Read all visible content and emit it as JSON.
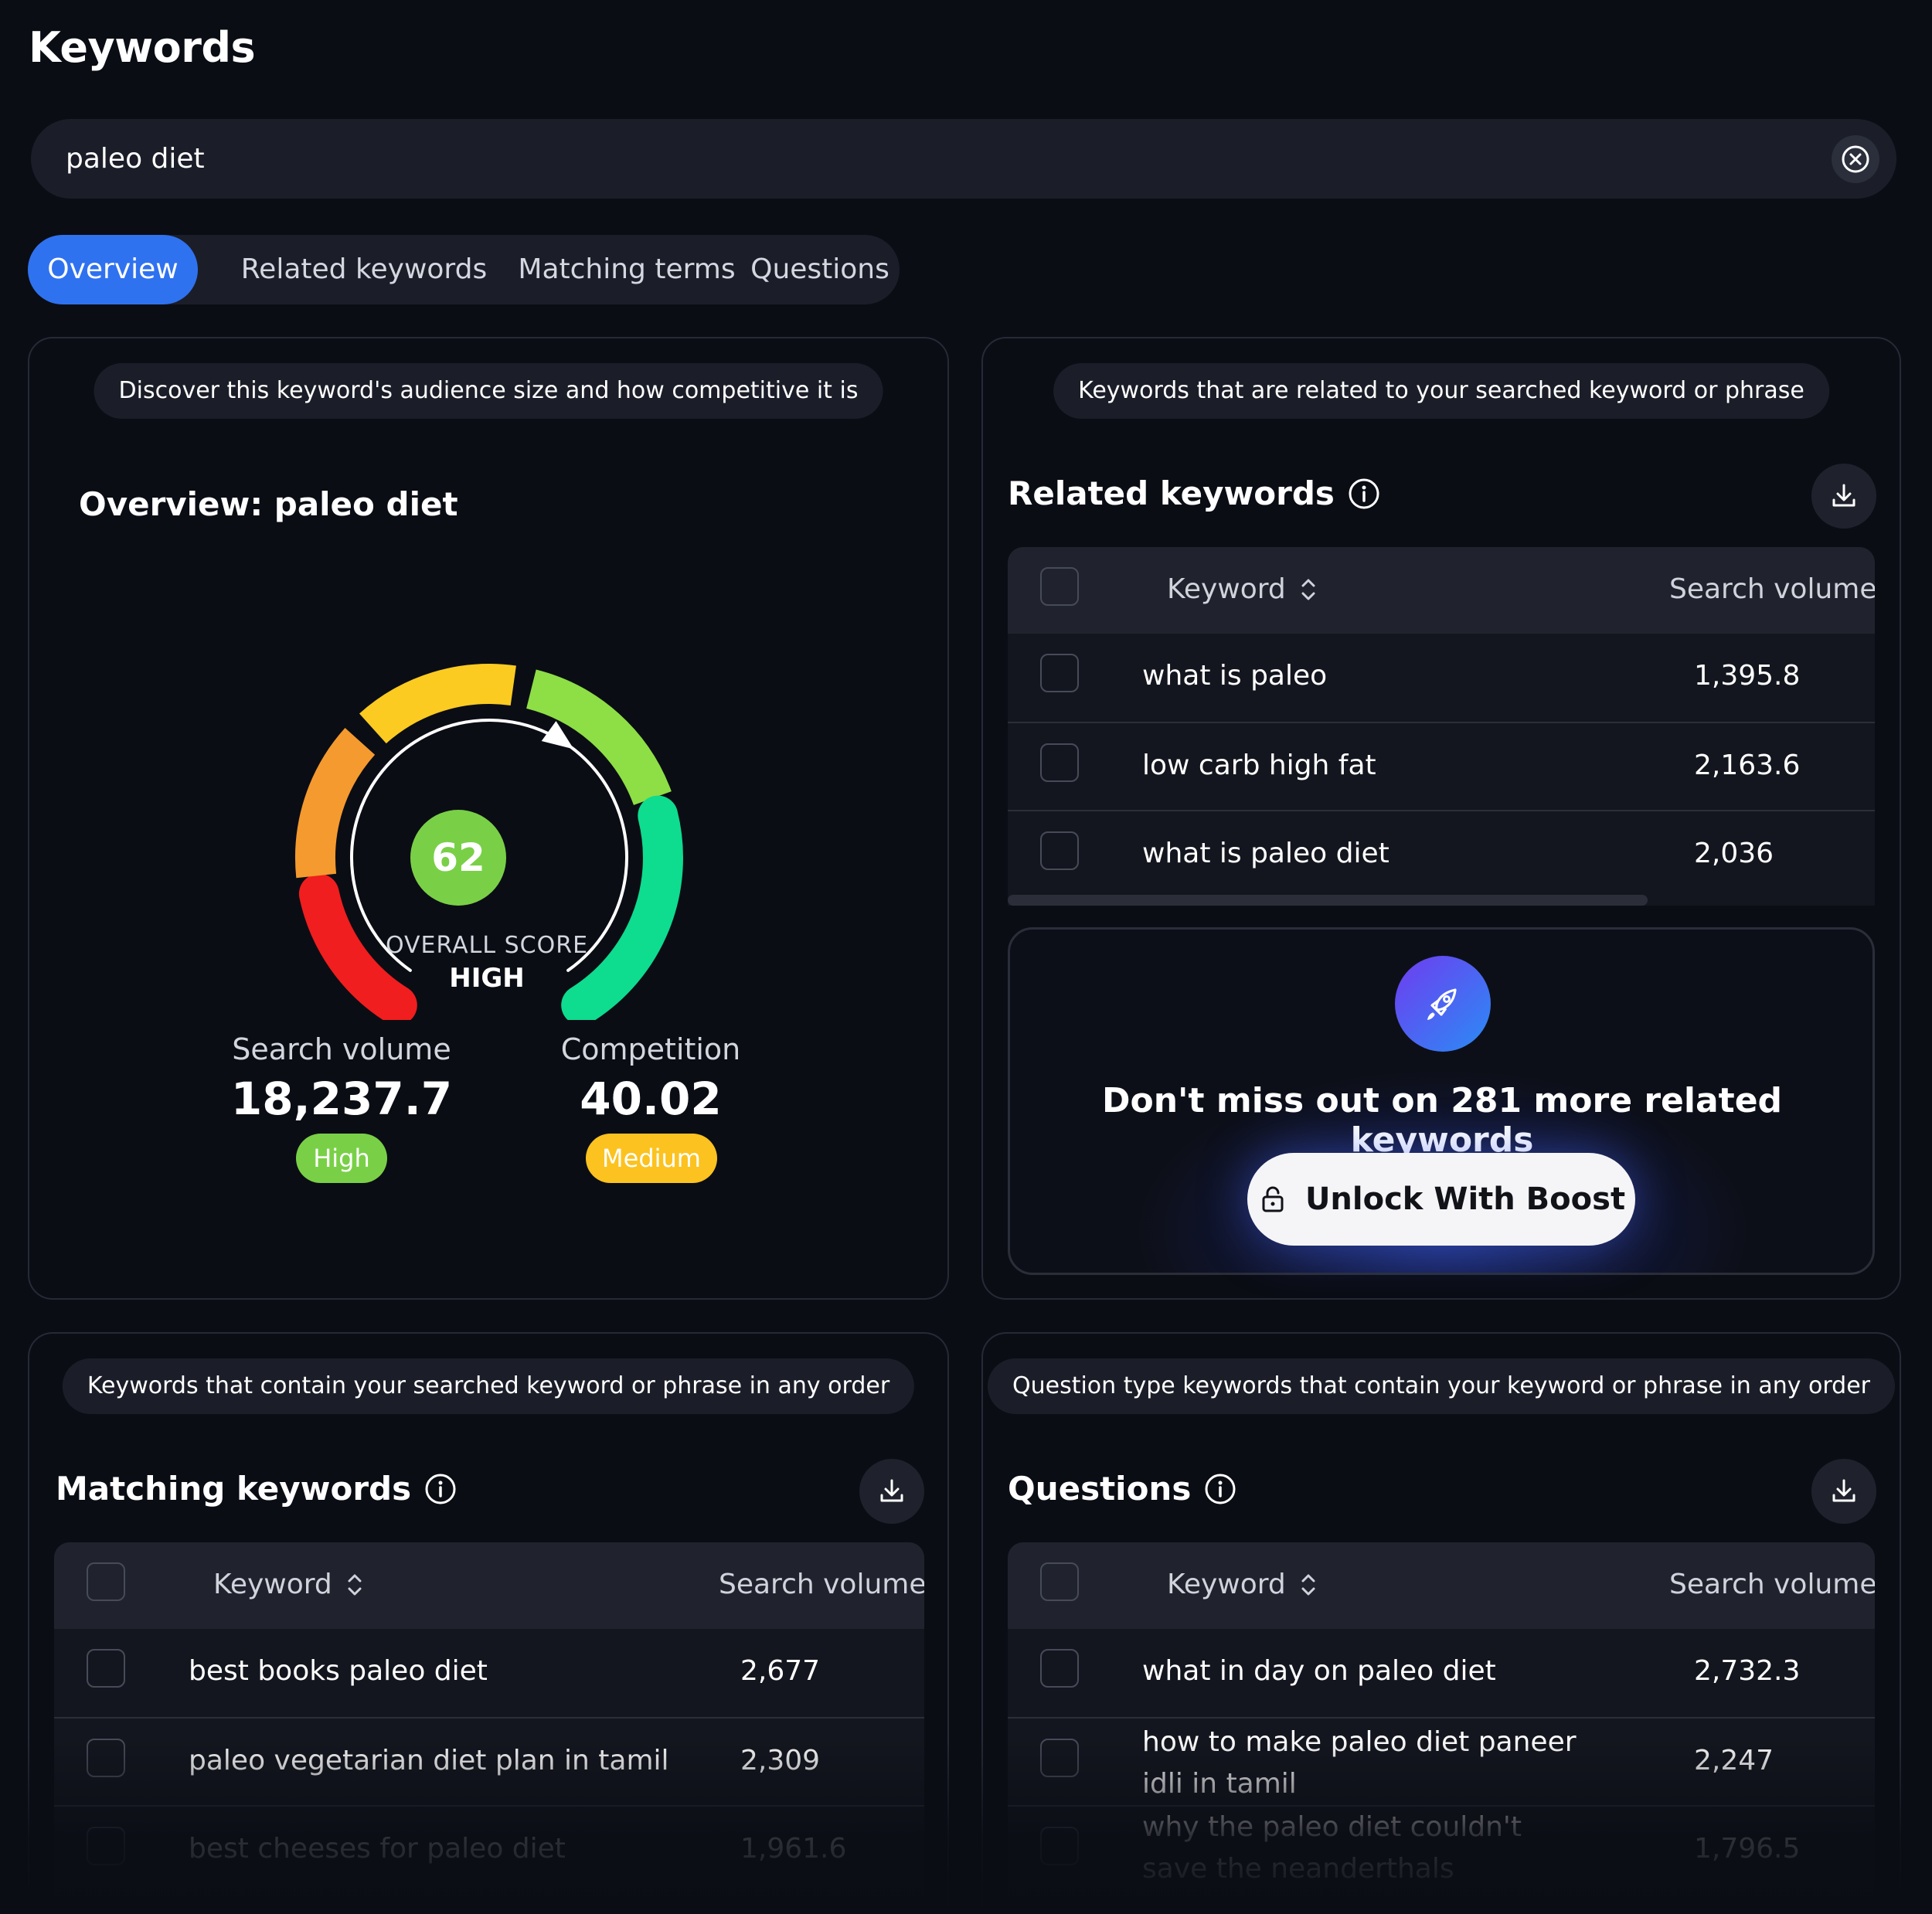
{
  "page": {
    "title": "Keywords"
  },
  "search": {
    "value": "paleo diet",
    "placeholder": ""
  },
  "tabs": [
    {
      "label": "Overview",
      "active": true
    },
    {
      "label": "Related keywords",
      "active": false
    },
    {
      "label": "Matching terms",
      "active": false
    },
    {
      "label": "Questions",
      "active": false
    }
  ],
  "overview": {
    "pill": "Discover this keyword's audience size and how competitive it is",
    "heading": "Overview: paleo diet",
    "score": "62",
    "score_fraction": 0.62,
    "score_label": "OVERALL SCORE",
    "score_rating": "HIGH",
    "search_volume_label": "Search volume",
    "search_volume_value": "18,237.7",
    "search_volume_badge": "High",
    "competition_label": "Competition",
    "competition_value": "40.02",
    "competition_badge": "Medium",
    "colors": {
      "red": "#f01e1e",
      "orange": "#f59a2e",
      "yellow": "#fccb22",
      "lightgreen": "#8ede46",
      "teal": "#0edc8e",
      "high_badge": "#79d047",
      "medium_badge": "#fcc21f"
    }
  },
  "related": {
    "pill": "Keywords that are related to your searched keyword or phrase",
    "heading": "Related keywords",
    "col_keyword": "Keyword",
    "col_volume": "Search volume",
    "rows": [
      {
        "keyword": "what is paleo",
        "volume": "1,395.8"
      },
      {
        "keyword": "low carb high fat",
        "volume": "2,163.6"
      },
      {
        "keyword": "what is paleo diet",
        "volume": "2,036"
      }
    ],
    "promo_text": "Don't miss out on 281 more related keywords",
    "unlock_label": "Unlock With Boost",
    "rocket_gradient": [
      "#6f3cf0",
      "#2a8cf5"
    ]
  },
  "matching": {
    "pill": "Keywords that contain your searched keyword or phrase in any order",
    "heading": "Matching keywords",
    "col_keyword": "Keyword",
    "col_volume": "Search volume",
    "rows": [
      {
        "keyword": "best books paleo diet",
        "volume": "2,677"
      },
      {
        "keyword": "paleo vegetarian diet plan in tamil",
        "volume": "2,309"
      },
      {
        "keyword": "best cheeses for paleo diet",
        "volume": "1,961.6"
      }
    ]
  },
  "questions": {
    "pill": "Question type keywords that contain your keyword or phrase in any order",
    "heading": "Questions",
    "col_keyword": "Keyword",
    "col_volume": "Search volume",
    "rows": [
      {
        "keyword": "what in day on paleo diet",
        "volume": "2,732.3"
      },
      {
        "keyword": "how to make paleo diet paneer idli in tamil",
        "volume": "2,247"
      },
      {
        "keyword": "why the paleo diet couldn't save the neanderthals",
        "volume": "1,796.5"
      }
    ]
  }
}
